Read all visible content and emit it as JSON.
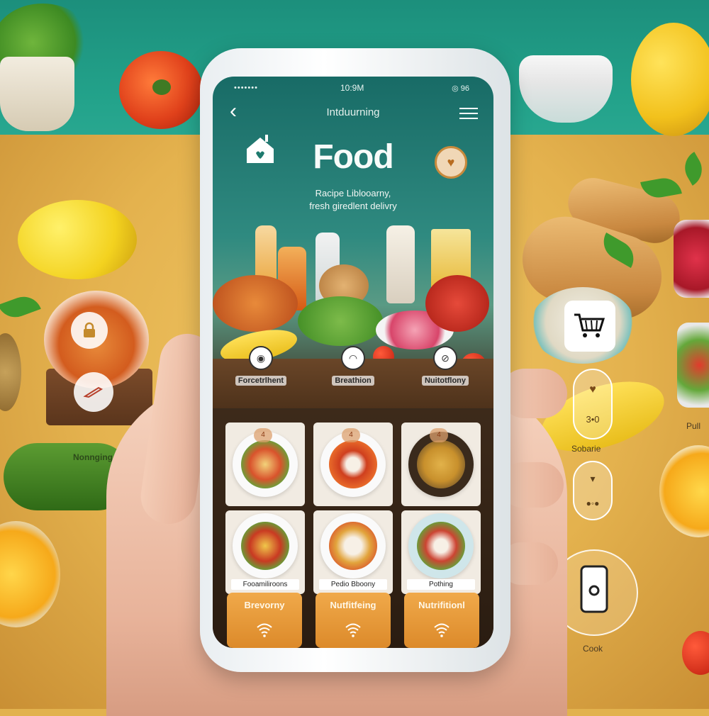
{
  "status_bar": {
    "left": "•••••••",
    "time": "10:9M",
    "right": "◎ 96"
  },
  "nav": {
    "title": "Intduurning"
  },
  "hero": {
    "title": "Food",
    "subtitle_line1": "Racipe Liblooarny,",
    "subtitle_line2": "fresh giredlent delivry"
  },
  "categories": [
    {
      "label": "Forcetrlhent",
      "icon": "camera-icon"
    },
    {
      "label": "Breathion",
      "icon": "shopping-bag-icon"
    },
    {
      "label": "Nuitotflony",
      "icon": "no-compass-icon"
    }
  ],
  "recipe_cards": [
    {
      "badge": "4",
      "label": "",
      "dish_color": "#d9532c"
    },
    {
      "badge": "4",
      "label": "",
      "dish_color": "#cf3f1e"
    },
    {
      "badge": "4",
      "label": "",
      "dish_color": "#c8902c"
    },
    {
      "badge": "",
      "label": "Fooamiliroons",
      "dish_color": "#c93a22"
    },
    {
      "badge": "",
      "label": "Pedio Bboony",
      "dish_color": "#e2a43c"
    },
    {
      "badge": "",
      "label": "Pothing",
      "dish_color": "#cc4432"
    }
  ],
  "tiles": [
    {
      "label": "Brevorny",
      "icon": "wifi-icon"
    },
    {
      "label": "Nutfitfeing",
      "icon": "wifi-icon"
    },
    {
      "label": "Nutrifitionl",
      "icon": "wifi-icon"
    }
  ],
  "side_labels": {
    "cucumber": "Nonnging",
    "pill": "Sobarie",
    "pill_value": "3•0",
    "cook": "Cook",
    "edge": "Pull"
  },
  "colors": {
    "accent": "#c88a3c",
    "screen_top": "#186b66",
    "tile_orange": "#e39a38",
    "table": "#e2b24e",
    "wall": "#1c8f7c"
  }
}
